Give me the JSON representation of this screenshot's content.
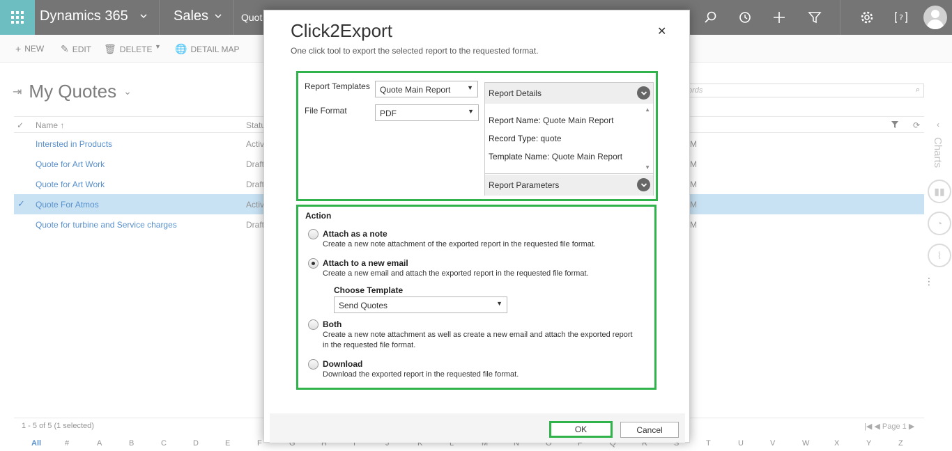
{
  "topnav": {
    "brand": "Dynamics 365",
    "area": "Sales",
    "crumb": "Quot"
  },
  "commandbar": {
    "new": "NEW",
    "edit": "EDIT",
    "delete": "DELETE",
    "detail_map": "DETAIL MAP"
  },
  "view": {
    "title": "My Quotes",
    "search_placeholder": "ords"
  },
  "grid": {
    "col_name": "Name ↑",
    "col_status": "Statu",
    "rows": [
      {
        "name": "Intersted in Products",
        "status": "Activ",
        "tail": "M"
      },
      {
        "name": "Quote for Art Work",
        "status": "Draft",
        "tail": "M"
      },
      {
        "name": "Quote for Art Work",
        "status": "Draft",
        "tail": "M"
      },
      {
        "name": "Quote For Atmos",
        "status": "Activ",
        "tail": "M"
      },
      {
        "name": "Quote for turbine and Service charges",
        "status": "Draft",
        "tail": "M"
      }
    ],
    "record_count": "1 - 5 of 5 (1 selected)",
    "page": "Page 1",
    "alphabet": [
      "All",
      "#",
      "A",
      "B",
      "C",
      "D",
      "E",
      "F",
      "G",
      "H",
      "I",
      "J",
      "K",
      "L",
      "M",
      "N",
      "O",
      "P",
      "Q",
      "R",
      "S",
      "T",
      "U",
      "V",
      "W",
      "X",
      "Y",
      "Z"
    ]
  },
  "rail": {
    "charts_label": "Charts"
  },
  "dialog": {
    "title": "Click2Export",
    "subtitle": "One click tool to export the selected report to the requested format.",
    "report_templates_label": "Report Templates",
    "report_templates_value": "Quote Main Report",
    "file_format_label": "File Format",
    "file_format_value": "PDF",
    "report_details_header": "Report Details",
    "report_name_label": "Report Name:",
    "report_name_value": "Quote Main Report",
    "record_type_label": "Record Type:",
    "record_type_value": "quote",
    "template_name_label": "Template Name:",
    "template_name_value": "Quote Main Report",
    "report_parameters_header": "Report Parameters",
    "action_title": "Action",
    "options": {
      "note_title": "Attach as a note",
      "note_desc": "Create a new note attachment of the exported report in the requested file format.",
      "email_title": "Attach to a new email",
      "email_desc": "Create a new email and attach the exported report in the requested file format.",
      "choose_template_label": "Choose Template",
      "choose_template_value": "Send Quotes",
      "both_title": "Both",
      "both_desc": "Create a new note attachment as well as create a new email and attach the exported report in the requested file format.",
      "download_title": "Download",
      "download_desc": "Download the exported report in the requested file format."
    },
    "ok_label": "OK",
    "cancel_label": "Cancel"
  },
  "colors": {
    "accent_teal": "#2fa3a6",
    "nav_dark": "#3a3a3a",
    "highlight_green": "#2fb34a",
    "link_blue": "#1160b7",
    "selected_row": "#b1d6f0"
  }
}
